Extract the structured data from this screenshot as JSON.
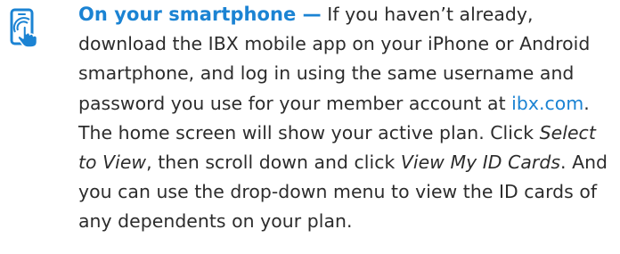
{
  "tip": {
    "icon": "smartphone-tap-icon",
    "accent_color": "#1b83d3",
    "text_color": "#2c2c2c",
    "lead": "On your smartphone —",
    "part_1": " If you haven’t already, download the IBX mobile app on your iPhone or Android smartphone, and log in using the same username and password you use for your member account at ",
    "link_text": "ibx.com",
    "part_2": ". The home screen will show your active plan. Click ",
    "select_to_view": "Select to View",
    "part_3": ", then scroll down and click ",
    "view_id_cards": "View My ID Cards",
    "part_4": ". And you can use the drop-down menu to view the ID cards of any dependents on your plan."
  }
}
